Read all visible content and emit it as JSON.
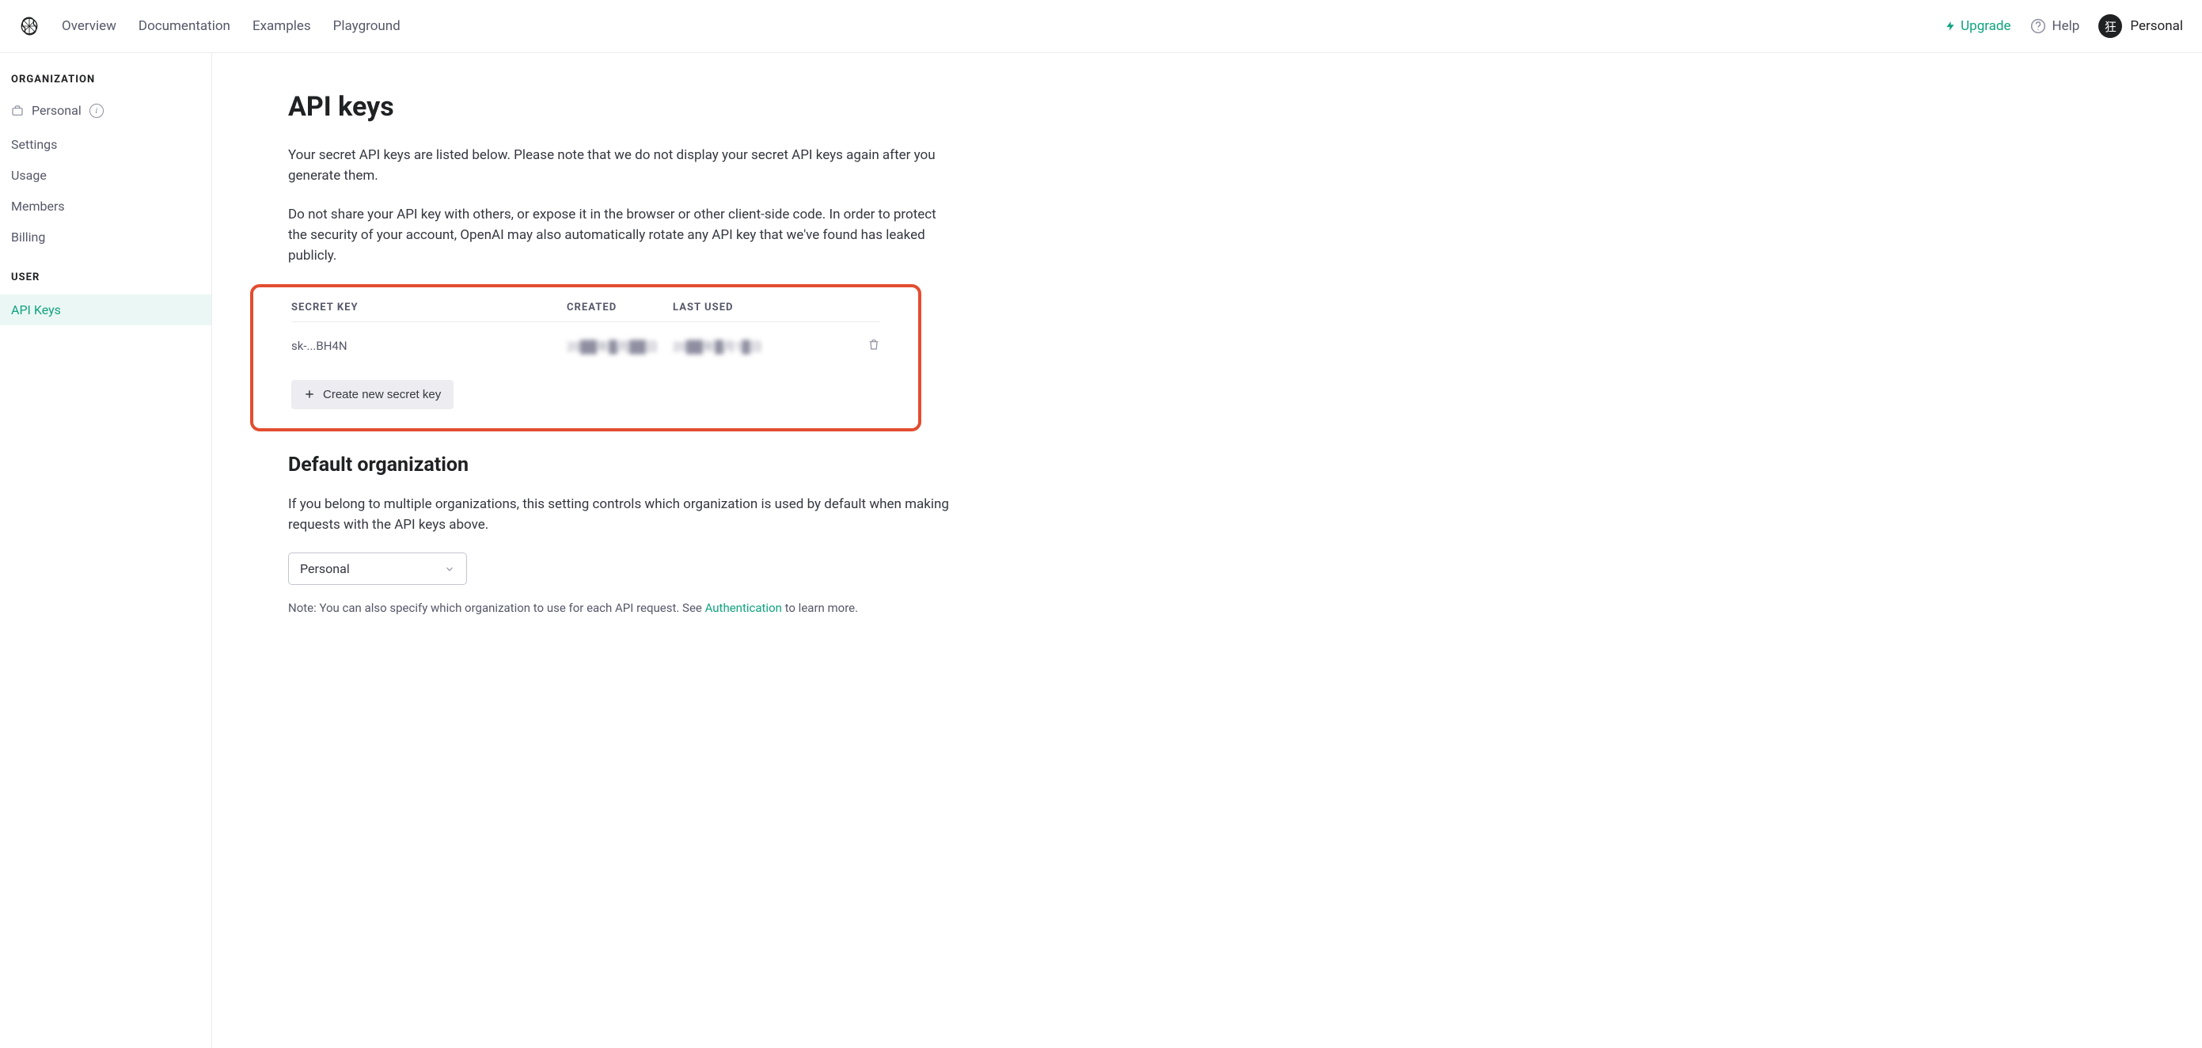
{
  "nav": {
    "overview": "Overview",
    "documentation": "Documentation",
    "examples": "Examples",
    "playground": "Playground"
  },
  "topbar": {
    "upgrade": "Upgrade",
    "help": "Help",
    "avatar_char": "狂",
    "account_label": "Personal"
  },
  "sidebar": {
    "org_title": "ORGANIZATION",
    "personal": "Personal",
    "settings": "Settings",
    "usage": "Usage",
    "members": "Members",
    "billing": "Billing",
    "user_title": "USER",
    "api_keys": "API Keys"
  },
  "main": {
    "title": "API keys",
    "intro1": "Your secret API keys are listed below. Please note that we do not display your secret API keys again after you generate them.",
    "intro2": "Do not share your API key with others, or expose it in the browser or other client-side code. In order to protect the security of your account, OpenAI may also automatically rotate any API key that we've found has leaked publicly.",
    "table": {
      "col_secret": "SECRET KEY",
      "col_created": "CREATED",
      "col_used": "LAST USED",
      "rows": [
        {
          "key": "sk-...BH4N",
          "created": "20██年█月██日",
          "used": "20██年█月1█日"
        }
      ]
    },
    "create_btn": "Create new secret key",
    "default_org_title": "Default organization",
    "default_org_para": "If you belong to multiple organizations, this setting controls which organization is used by default when making requests with the API keys above.",
    "org_select": "Personal",
    "note_prefix": "Note: You can also specify which organization to use for each API request. See ",
    "note_link": "Authentication",
    "note_suffix": " to learn more."
  }
}
